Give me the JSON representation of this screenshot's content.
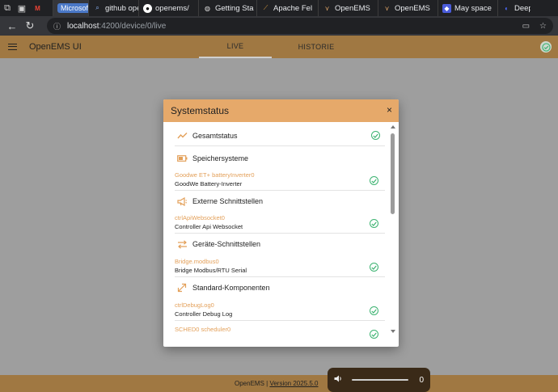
{
  "browser": {
    "tabs": [
      {
        "label": "",
        "icon": "gmail-icon"
      },
      {
        "label": "Microsoft",
        "icon": "microsoft-icon"
      },
      {
        "label": "github open",
        "icon": "search-icon"
      },
      {
        "label": "openems/",
        "icon": "github-icon"
      },
      {
        "label": "Getting Sta",
        "icon": "globe-icon"
      },
      {
        "label": "Apache Fel",
        "icon": "apache-icon"
      },
      {
        "label": "OpenEMS",
        "icon": "openems-icon"
      },
      {
        "label": "OpenEMS",
        "icon": "openems-icon"
      },
      {
        "label": "May space",
        "icon": "app-icon"
      },
      {
        "label": "DeepS",
        "icon": "deepseek-icon"
      }
    ],
    "url_host": "localhost",
    "url_path": ":4200/device/0/live"
  },
  "app": {
    "title": "OpenEMS UI",
    "tabs": {
      "live": "LIVE",
      "historie": "HISTORIE"
    }
  },
  "modal": {
    "title": "Systemstatus",
    "close": "×",
    "sections": [
      {
        "label": "Gesamtstatus",
        "icon": "trend-icon",
        "ok": true
      },
      {
        "label": "Speichersysteme",
        "icon": "battery-icon"
      },
      {
        "label": "Externe Schnittstellen",
        "icon": "megaphone-icon"
      },
      {
        "label": "Geräte-Schnittstellen",
        "icon": "swap-icon"
      },
      {
        "label": "Standard-Komponenten",
        "icon": "resize-icon"
      }
    ],
    "components": [
      {
        "id": "Goodwe ET+ batteryInverter0",
        "alias": "GoodWe Battery-Inverter"
      },
      {
        "id": "ctrlApiWebsocket0",
        "alias": "Controller Api Websocket"
      },
      {
        "id": "Bridge.modbus0",
        "alias": "Bridge Modbus/RTU Serial"
      },
      {
        "id": "ctrlDebugLog0",
        "alias": "Controller Debug Log"
      },
      {
        "id": "SCHED0 scheduler0",
        "alias": ""
      }
    ]
  },
  "footer": {
    "brand": "OpenEMS",
    "sep": " | ",
    "version": "Version 2025.5.0"
  },
  "media": {
    "count": "0"
  },
  "colors": {
    "accent": "#e6a96a",
    "appbar": "#a07842",
    "ok": "#3cb371"
  }
}
